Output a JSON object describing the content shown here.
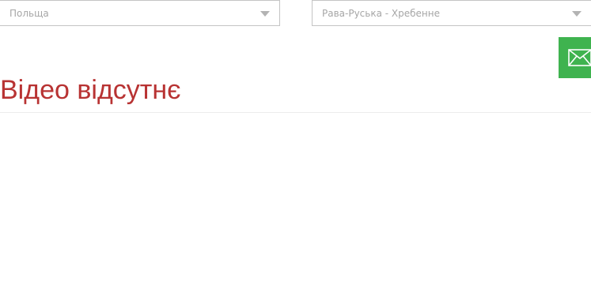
{
  "filters": {
    "country": {
      "value": "Польща"
    },
    "crossing": {
      "value": "Рава-Руська - Хребенне"
    }
  },
  "contact_button": {
    "icon": "envelope-icon",
    "color": "#3fb34f"
  },
  "video": {
    "status_text": "Відео відсутнє",
    "color": "#b83333"
  }
}
